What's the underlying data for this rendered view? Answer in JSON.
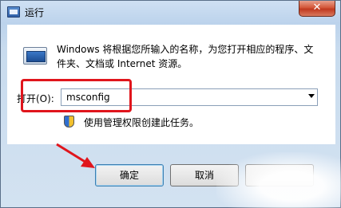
{
  "window": {
    "title": "运行",
    "close_label": "✕"
  },
  "dialog": {
    "description": "Windows 将根据您所输入的名称，为您打开相应的程序、文件夹、文档或 Internet 资源。",
    "open_label": "打开(O):",
    "open_value": "msconfig",
    "admin_note": "使用管理权限创建此任务。"
  },
  "buttons": {
    "ok": "确定",
    "cancel": "取消",
    "browse": ""
  },
  "colors": {
    "annotation": "#e0151c",
    "accent": "#3c7fb1"
  }
}
